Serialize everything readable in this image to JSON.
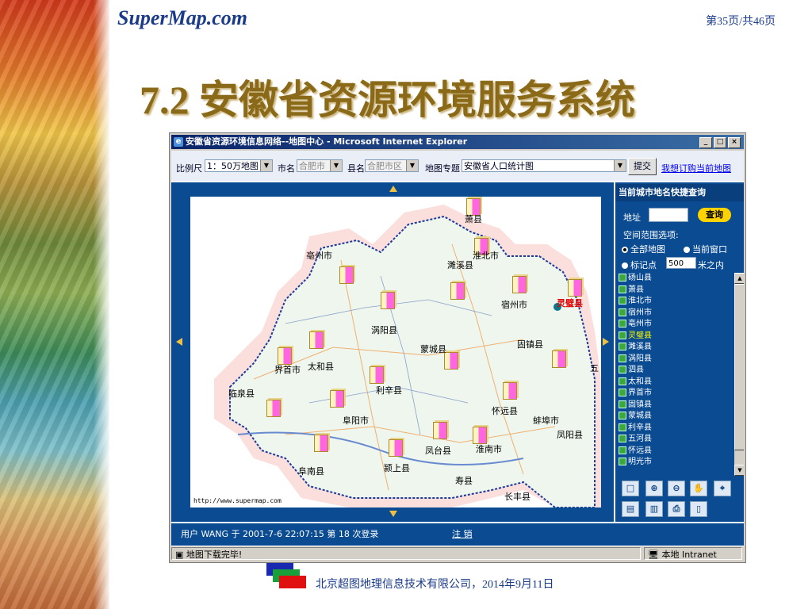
{
  "slide": {
    "logo": "SuperMap.com",
    "page_indicator": "第35页/共46页",
    "title": "7.2  安徽省资源环境服务系统",
    "footer": "北京超图地理信息技术有限公司，2014年9月11日"
  },
  "browser": {
    "window_title": "安徽省资源环境信息网络--地图中心 - Microsoft Internet Explorer",
    "status_text": "地图下载完毕!",
    "zone_text": "本地 Intranet"
  },
  "toolbar": {
    "scale_label": "比例尺",
    "scale_value": "1：50万地图",
    "city_label": "市名",
    "city_value": "合肥市",
    "county_label": "县名",
    "county_value": "合肥市区",
    "theme_label": "地图专题",
    "theme_value": "安徽省人口统计图",
    "submit_label": "提交",
    "subscribe_link": "我想订购当前地图"
  },
  "map": {
    "url_text": "http://www.supermap.com",
    "labels": [
      {
        "name": "萧县"
      },
      {
        "name": "亳州市"
      },
      {
        "name": "淮北市"
      },
      {
        "name": "濉溪县"
      },
      {
        "name": "宿州市"
      },
      {
        "name": "灵璧县",
        "highlight": true
      },
      {
        "name": "涡阳县"
      },
      {
        "name": "蒙城县"
      },
      {
        "name": "固镇县"
      },
      {
        "name": "界首市"
      },
      {
        "name": "太和县"
      },
      {
        "name": "五"
      },
      {
        "name": "临泉县"
      },
      {
        "name": "利辛县"
      },
      {
        "name": "阜阳市"
      },
      {
        "name": "怀远县"
      },
      {
        "name": "蚌埠市"
      },
      {
        "name": "凤阳县"
      },
      {
        "name": "凤台县"
      },
      {
        "name": "淮南市"
      },
      {
        "name": "颍上县"
      },
      {
        "name": "阜南县"
      },
      {
        "name": "寿县"
      },
      {
        "name": "长丰县"
      }
    ]
  },
  "query_panel": {
    "title": "当前城市地名快捷查询",
    "address_label": "地址",
    "query_button": "查询",
    "range_label": "空间范围选项:",
    "opt_all": "全部地图",
    "opt_current": "当前窗口",
    "opt_marker": "标记点",
    "distance_value": "500",
    "distance_suffix": "米之内",
    "places": [
      "砀山县",
      "萧县",
      "淮北市",
      "宿州市",
      "亳州市",
      "灵璧县",
      "濉溪县",
      "涡阳县",
      "泗县",
      "太和县",
      "界首市",
      "固镇县",
      "蒙城县",
      "利辛县",
      "五河县",
      "怀远县",
      "明光市"
    ],
    "highlighted_place": "灵璧县",
    "tools": [
      "select-tool",
      "zoom-in-tool",
      "zoom-out-tool",
      "pan-tool",
      "center-tool",
      "book-tool",
      "open-book-tool",
      "print-tool",
      "document-tool"
    ]
  },
  "userbar": {
    "text": "用户 WANG  于 2001-7-6 22:07:15 第 18 次登录",
    "logout": "注 销"
  },
  "colors": {
    "panel_blue": "#0a4b92",
    "title_gold": "#8a6a18",
    "highlight_red": "#e00000"
  }
}
